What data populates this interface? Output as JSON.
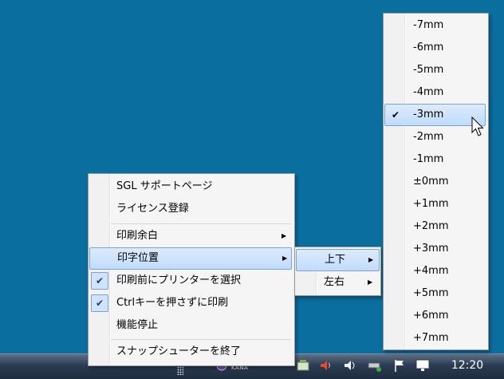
{
  "taskbar": {
    "clock": "12:20",
    "ime_label": "KANA",
    "tray_icons": [
      "ime-icon",
      "network-icon",
      "volume-icon",
      "speaker-icon",
      "safely-remove-icon",
      "action-center-flag-icon",
      "display-icon"
    ]
  },
  "main_menu": {
    "items": [
      {
        "label": "SGL サポートページ"
      },
      {
        "label": "ライセンス登録"
      },
      {
        "label": "印刷余白",
        "submenu": true
      },
      {
        "label": "印字位置",
        "submenu": true,
        "highlighted": true
      },
      {
        "label": "印刷前にプリンターを選択",
        "checked": true
      },
      {
        "label": "Ctrlキーを押さずに印刷",
        "checked": true
      },
      {
        "label": "機能停止"
      },
      {
        "label": "スナップシューターを終了"
      }
    ]
  },
  "position_menu": {
    "items": [
      {
        "label": "上下",
        "highlighted": true,
        "submenu": true
      },
      {
        "label": "左右",
        "submenu": true
      }
    ]
  },
  "offset_menu": {
    "items": [
      "-7mm",
      "-6mm",
      "-5mm",
      "-4mm",
      "-3mm",
      "-2mm",
      "-1mm",
      "±0mm",
      "+1mm",
      "+2mm",
      "+3mm",
      "+4mm",
      "+5mm",
      "+6mm",
      "+7mm"
    ],
    "selected": "-3mm"
  },
  "check_glyph": "✔",
  "arrow_glyph": "▶"
}
